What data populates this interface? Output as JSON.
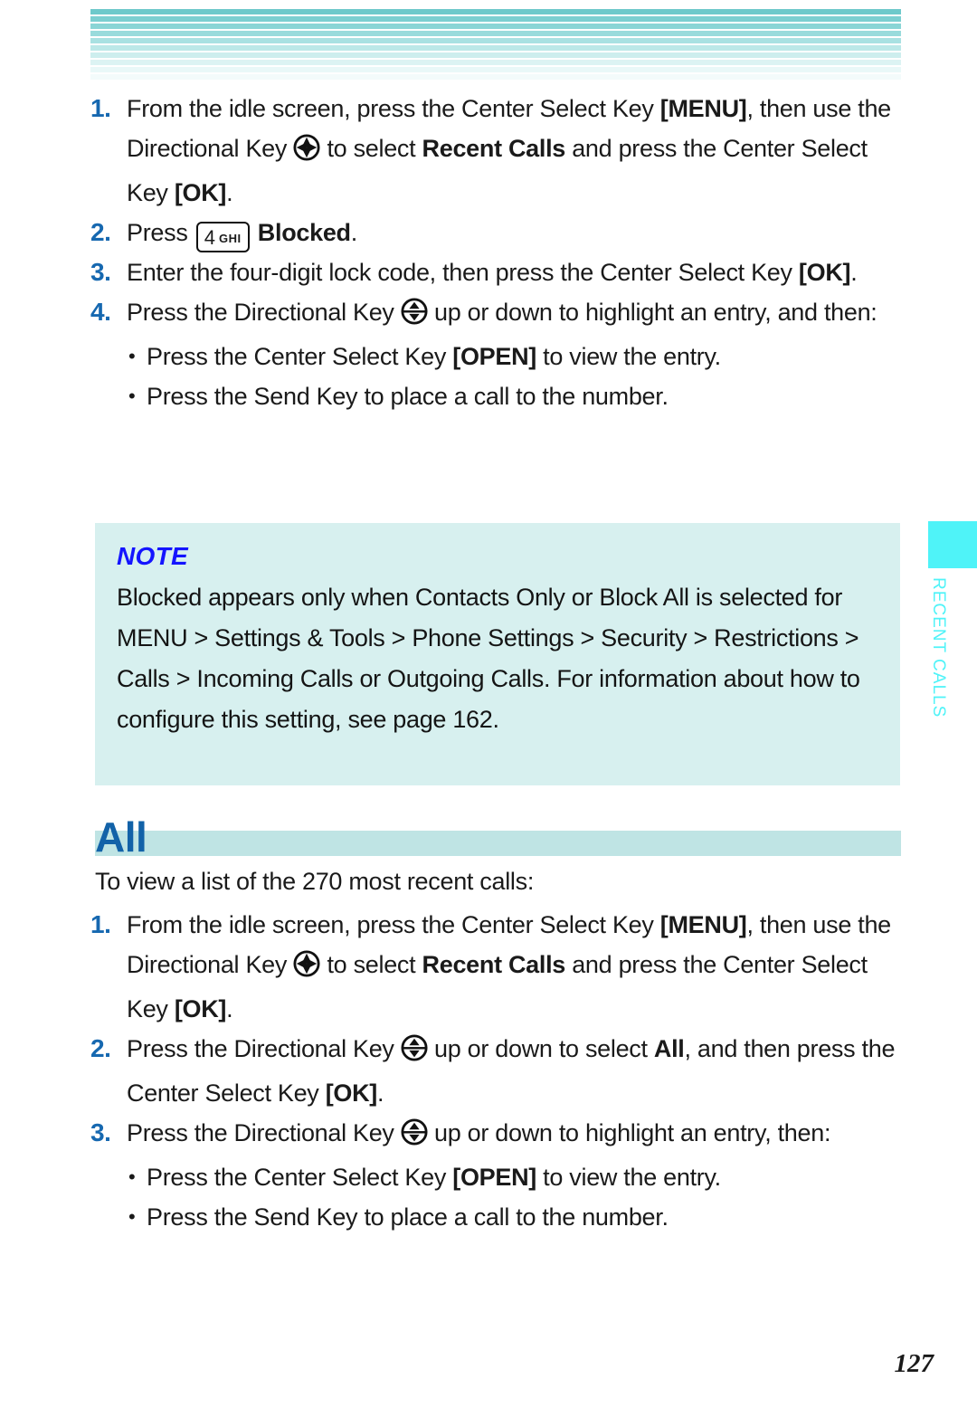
{
  "page": {
    "number": "127",
    "side_tab_label": "RECENT CALLS",
    "colors": {
      "step_number": "#1668b0",
      "heading": "#1262a8",
      "heading_bar": "#bfe4e4",
      "note_bg": "#d7f0ef",
      "note_title": "#1414ff",
      "side_tab": "#4ff3f8",
      "stripe_top": "#6ec9cb"
    }
  },
  "header": {
    "stripes": [
      "#6ec9cb",
      "#7ccfd1",
      "#8ad5d6",
      "#99dbdc",
      "#a9e1e2",
      "#bce8e8",
      "#cdeeee",
      "#dcf3f3",
      "#e9f8f8",
      "#f3fbfb"
    ]
  },
  "blocked_steps": [
    {
      "num": "1.",
      "parts": [
        {
          "t": "From the idle screen, press the Center Select Key ",
          "s": "n"
        },
        {
          "t": "[MENU]",
          "s": "b"
        },
        {
          "t": ", then use the Directional Key ",
          "s": "n"
        },
        {
          "t": "",
          "s": "icon-dpad"
        },
        {
          "t": " to select ",
          "s": "n"
        },
        {
          "t": "Recent Calls",
          "s": "b"
        },
        {
          "t": " and press the Center Select Key ",
          "s": "n"
        },
        {
          "t": "[OK]",
          "s": "b"
        },
        {
          "t": ".",
          "s": "n"
        }
      ]
    },
    {
      "num": "2.",
      "parts": [
        {
          "t": "Press ",
          "s": "n"
        },
        {
          "t": "",
          "s": "icon-key4"
        },
        {
          "t": " ",
          "s": "n"
        },
        {
          "t": "Blocked",
          "s": "b"
        },
        {
          "t": ".",
          "s": "n"
        }
      ]
    },
    {
      "num": "3.",
      "parts": [
        {
          "t": "Enter the four-digit lock code, then press the Center Select Key ",
          "s": "n"
        },
        {
          "t": "[OK]",
          "s": "b"
        },
        {
          "t": ".",
          "s": "n"
        }
      ]
    },
    {
      "num": "4.",
      "parts": [
        {
          "t": "Press the Directional Key ",
          "s": "n"
        },
        {
          "t": "",
          "s": "icon-updown"
        },
        {
          "t": " up or down to highlight an entry, and then:",
          "s": "n"
        }
      ]
    }
  ],
  "blocked_bullets": [
    {
      "dot": "•",
      "parts": [
        {
          "t": "Press the Center Select Key ",
          "s": "n"
        },
        {
          "t": "[OPEN]",
          "s": "b"
        },
        {
          "t": " to view the entry.",
          "s": "n"
        }
      ]
    },
    {
      "dot": "•",
      "parts": [
        {
          "t": "Press the Send Key to place a call to the number.",
          "s": "n"
        }
      ]
    }
  ],
  "note": {
    "title": "NOTE",
    "text": "Blocked appears only when Contacts Only or Block All is selected for MENU > Settings & Tools > Phone Settings > Security > Restrictions > Calls > Incoming Calls or Outgoing Calls. For information about how to configure this setting, see page 162."
  },
  "all_section": {
    "title": "All",
    "intro": "To view a list of the 270 most recent calls:",
    "steps": [
      {
        "num": "1.",
        "parts": [
          {
            "t": "From the idle screen, press the Center Select Key ",
            "s": "n"
          },
          {
            "t": "[MENU]",
            "s": "b"
          },
          {
            "t": ", then use the Directional Key ",
            "s": "n"
          },
          {
            "t": "",
            "s": "icon-dpad"
          },
          {
            "t": " to select ",
            "s": "n"
          },
          {
            "t": "Recent Calls",
            "s": "b"
          },
          {
            "t": " and press the Center Select Key ",
            "s": "n"
          },
          {
            "t": "[OK]",
            "s": "b"
          },
          {
            "t": ".",
            "s": "n"
          }
        ]
      },
      {
        "num": "2.",
        "parts": [
          {
            "t": "Press the Directional Key ",
            "s": "n"
          },
          {
            "t": "",
            "s": "icon-updown"
          },
          {
            "t": " up or down to select ",
            "s": "n"
          },
          {
            "t": "All",
            "s": "b"
          },
          {
            "t": ", and then press the Center Select Key ",
            "s": "n"
          },
          {
            "t": "[OK]",
            "s": "b"
          },
          {
            "t": ".",
            "s": "n"
          }
        ]
      },
      {
        "num": "3.",
        "parts": [
          {
            "t": "Press the Directional Key ",
            "s": "n"
          },
          {
            "t": "",
            "s": "icon-updown"
          },
          {
            "t": " up or down to highlight an entry, then:",
            "s": "n"
          }
        ]
      }
    ],
    "bullets": [
      {
        "dot": "•",
        "parts": [
          {
            "t": "Press the Center Select Key ",
            "s": "n"
          },
          {
            "t": "[OPEN]",
            "s": "b"
          },
          {
            "t": " to view the entry.",
            "s": "n"
          }
        ]
      },
      {
        "dot": "•",
        "parts": [
          {
            "t": "Press the Send Key to place a call to the number.",
            "s": "n"
          }
        ]
      }
    ]
  },
  "icons": {
    "dpad": {
      "name": "directional-key-icon",
      "key_number": ""
    },
    "updown": {
      "name": "directional-key-updown-icon"
    },
    "key4": {
      "name": "keypad-4-ghi-icon",
      "number": "4",
      "letters": "GHI"
    }
  }
}
